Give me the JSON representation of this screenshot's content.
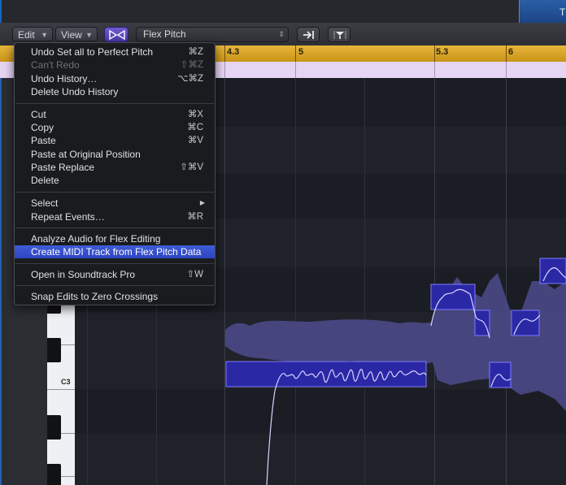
{
  "window": {
    "partial_tab_label": "T"
  },
  "toolbar": {
    "edit_label": "Edit",
    "view_label": "View",
    "flex_mode_icon": "flex-pitch-icon",
    "flex_mode_value": "Flex Pitch",
    "catch_icon": "catch-playhead-icon",
    "link_icon": "link-filter-icon"
  },
  "ruler": {
    "bars": [
      "4.3",
      "5",
      "5.3",
      "6"
    ]
  },
  "keyboard": {
    "c3_label": "C3"
  },
  "edit_menu": {
    "items": [
      {
        "label": "Undo Set all to Perfect Pitch",
        "shortcut": "⌘Z",
        "enabled": true
      },
      {
        "label": "Can't Redo",
        "shortcut": "⇧⌘Z",
        "enabled": false
      },
      {
        "label": "Undo History…",
        "shortcut": "⌥⌘Z",
        "enabled": true
      },
      {
        "label": "Delete Undo History",
        "shortcut": "",
        "enabled": true
      },
      {
        "label": "Cut",
        "shortcut": "⌘X",
        "enabled": true
      },
      {
        "label": "Copy",
        "shortcut": "⌘C",
        "enabled": true
      },
      {
        "label": "Paste",
        "shortcut": "⌘V",
        "enabled": true
      },
      {
        "label": "Paste at Original Position",
        "shortcut": "",
        "enabled": true
      },
      {
        "label": "Paste Replace",
        "shortcut": "⇧⌘V",
        "enabled": true
      },
      {
        "label": "Delete",
        "shortcut": "",
        "enabled": true
      },
      {
        "label": "Select",
        "shortcut": "",
        "enabled": true,
        "submenu": true
      },
      {
        "label": "Repeat Events…",
        "shortcut": "⌘R",
        "enabled": true
      },
      {
        "label": "Analyze Audio for Flex Editing",
        "shortcut": "",
        "enabled": true
      },
      {
        "label": "Create MIDI Track from Flex Pitch Data",
        "shortcut": "",
        "enabled": true,
        "highlighted": true
      },
      {
        "label": "Open in Soundtrack Pro",
        "shortcut": "⇧W",
        "enabled": true
      },
      {
        "label": "Snap Edits to Zero Crossings",
        "shortcut": "",
        "enabled": true
      }
    ]
  },
  "colors": {
    "ruler": "#d9a428",
    "marker_lane": "#e5d4f2",
    "note_fill": "#2d2aa8",
    "pitch_curve": "#d7d5ff",
    "waveform": "#4b4a8a",
    "menu_highlight": "#3a55d0"
  }
}
